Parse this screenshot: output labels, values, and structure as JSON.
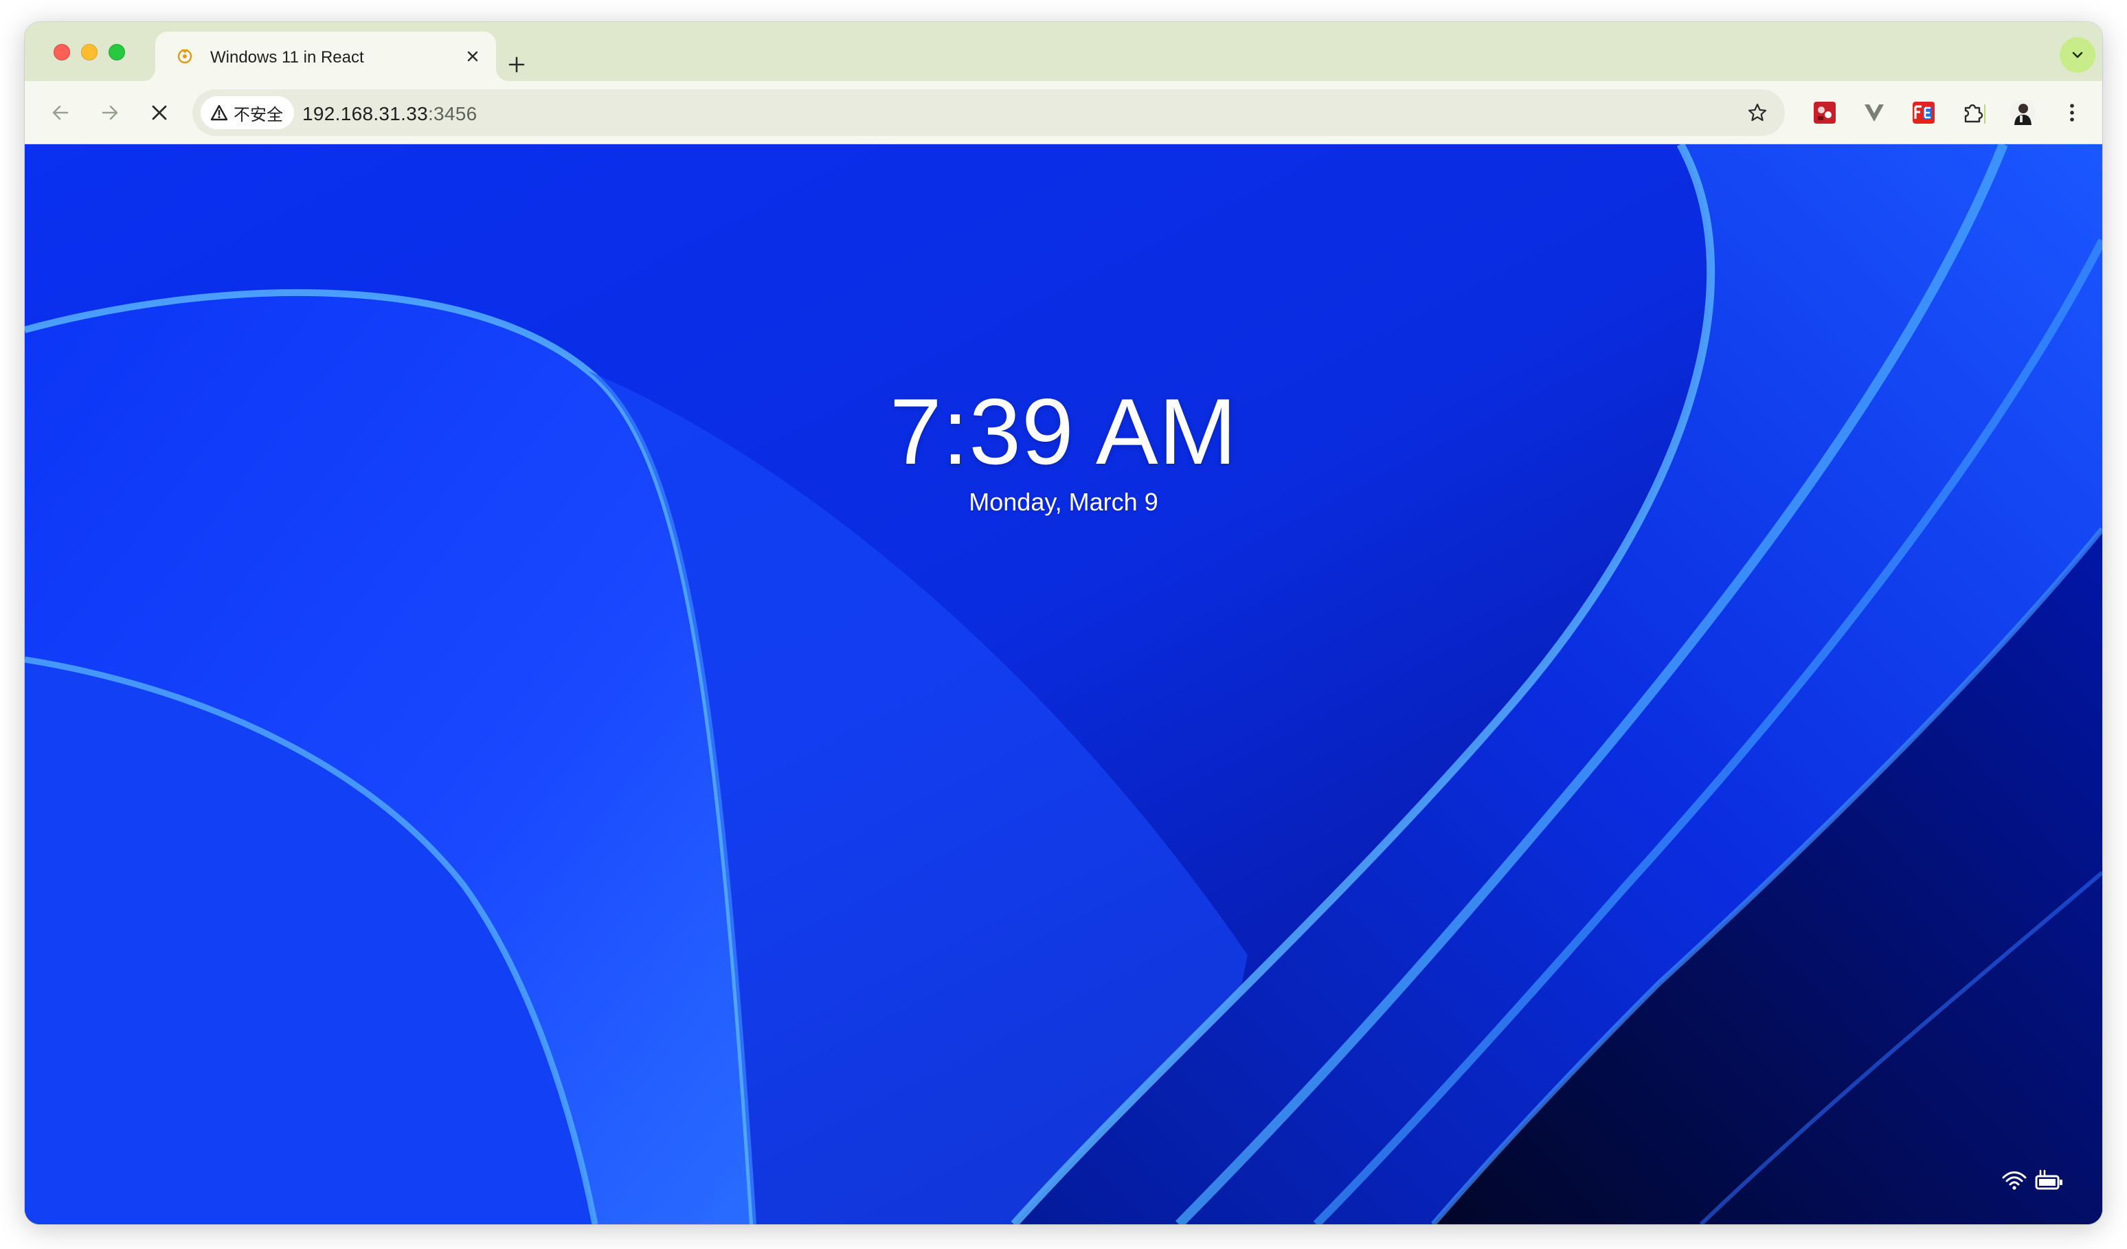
{
  "browser": {
    "tab": {
      "title": "Windows 11 in React",
      "favicon": "react-favicon-icon"
    },
    "toolbar": {
      "security_label": "不安全",
      "url_host": "192.168.31.33",
      "url_port": ":3456"
    },
    "extensions": [
      "puzzle-game-extension-icon",
      "v-extension-icon",
      "fe-extension-icon",
      "extensions-puzzle-icon"
    ]
  },
  "lockscreen": {
    "time": "7:39 AM",
    "date": "Monday, March 9"
  },
  "tray": {
    "icons": [
      "wifi-icon",
      "battery-icon"
    ]
  },
  "colors": {
    "tab_strip_bg": "#dfe8cc",
    "toolbar_bg": "#f6f8ef",
    "wallpaper_base": "#0f2fe0",
    "wallpaper_highlight": "#4aa8ff"
  }
}
